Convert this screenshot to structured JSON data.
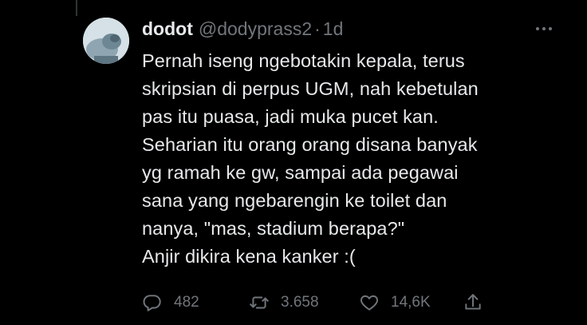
{
  "tweet": {
    "author": {
      "display_name": "dodot",
      "handle": "@dodyprass2",
      "separator": "·",
      "timestamp": "1d"
    },
    "text_lines": [
      "Pernah iseng ngebotakin kepala, terus",
      "skripsian di perpus UGM, nah kebetulan",
      "pas itu puasa, jadi muka pucet kan.",
      "Seharian itu orang orang disana banyak",
      "yg ramah ke gw, sampai ada pegawai",
      "sana yang ngebarengin ke toilet dan",
      "nanya, \"mas, stadium berapa?\"",
      "Anjir dikira kena kanker :("
    ],
    "actions": {
      "reply_count": "482",
      "retweet_count": "3.658",
      "like_count": "14,6K"
    }
  },
  "icons": {
    "more": "more-dots-icon",
    "reply": "reply-bubble-icon",
    "retweet": "retweet-icon",
    "like": "heart-icon",
    "share": "share-icon"
  },
  "colors": {
    "background": "#000000",
    "text_primary": "#e7e9ea",
    "text_secondary": "#71767b",
    "thread_line": "#2f3336"
  }
}
